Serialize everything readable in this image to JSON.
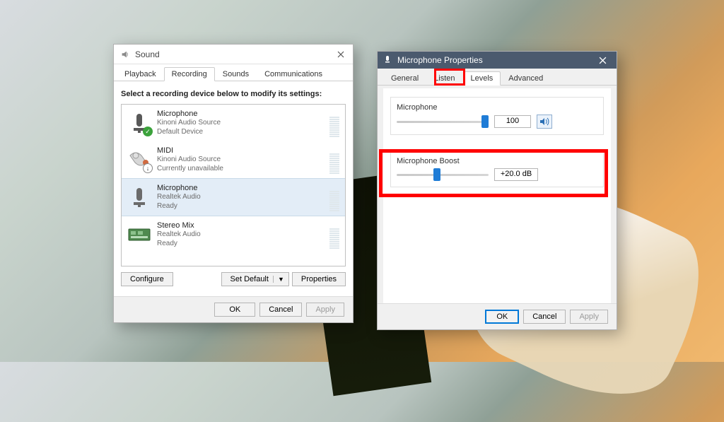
{
  "sound_window": {
    "title": "Sound",
    "tabs": [
      "Playback",
      "Recording",
      "Sounds",
      "Communications"
    ],
    "active_tab_index": 1,
    "instruction": "Select a recording device below to modify its settings:",
    "devices": [
      {
        "name": "Microphone",
        "source": "Kinoni Audio Source",
        "status": "Default Device",
        "badge": "ok"
      },
      {
        "name": "MIDI",
        "source": "Kinoni Audio Source",
        "status": "Currently unavailable",
        "badge": "down"
      },
      {
        "name": "Microphone",
        "source": "Realtek Audio",
        "status": "Ready",
        "badge": ""
      },
      {
        "name": "Stereo Mix",
        "source": "Realtek Audio",
        "status": "Ready",
        "badge": ""
      }
    ],
    "selected_device_index": 2,
    "buttons": {
      "configure": "Configure",
      "set_default": "Set Default",
      "properties": "Properties"
    },
    "dialog": {
      "ok": "OK",
      "cancel": "Cancel",
      "apply": "Apply"
    }
  },
  "mic_properties": {
    "title": "Microphone Properties",
    "tabs": [
      "General",
      "Listen",
      "Levels",
      "Advanced"
    ],
    "active_tab_index": 2,
    "microphone": {
      "label": "Microphone",
      "value": "100",
      "percent": 100
    },
    "boost": {
      "label": "Microphone Boost",
      "value": "+20.0 dB",
      "percent": 40
    },
    "dialog": {
      "ok": "OK",
      "cancel": "Cancel",
      "apply": "Apply"
    }
  }
}
